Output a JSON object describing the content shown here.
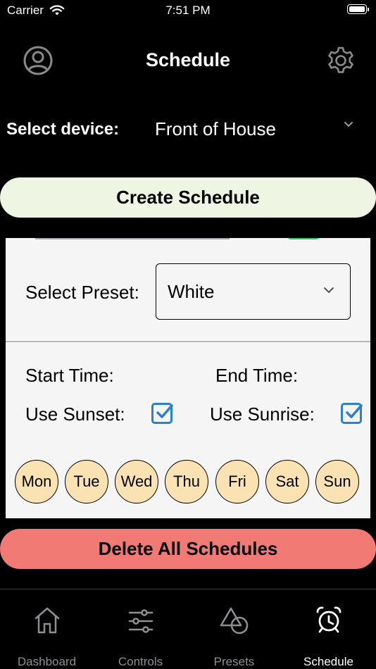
{
  "status_bar": {
    "carrier": "Carrier",
    "time": "7:51 PM"
  },
  "header": {
    "title": "Schedule",
    "profile_icon": "person-circle-icon",
    "settings_icon": "gear-icon"
  },
  "device": {
    "label": "Select device:",
    "selected": "Front of House"
  },
  "create_button": "Create Schedule",
  "schedule_card": {
    "preset_label": "Select Preset:",
    "preset_value": "White",
    "start_time_label": "Start Time:",
    "end_time_label": "End Time:",
    "use_sunset_label": "Use Sunset:",
    "use_sunset_checked": true,
    "use_sunrise_label": "Use Sunrise:",
    "use_sunrise_checked": true,
    "days": [
      "Mon",
      "Tue",
      "Wed",
      "Thu",
      "Fri",
      "Sat",
      "Sun"
    ]
  },
  "delete_button": "Delete All Schedules",
  "tab_bar": {
    "tabs": [
      {
        "label": "Dashboard",
        "icon": "house-icon",
        "active": false
      },
      {
        "label": "Controls",
        "icon": "sliders-icon",
        "active": false
      },
      {
        "label": "Presets",
        "icon": "shapes-icon",
        "active": false
      },
      {
        "label": "Schedule",
        "icon": "alarm-clock-icon",
        "active": true
      }
    ]
  },
  "colors": {
    "background": "#000000",
    "create_button": "#eef5e2",
    "delete_button": "#f27a74",
    "day_fill": "#fbe2b3",
    "checkbox": "#2c7ed6",
    "tab_inactive": "#8e8e93",
    "tab_active": "#ffffff"
  }
}
